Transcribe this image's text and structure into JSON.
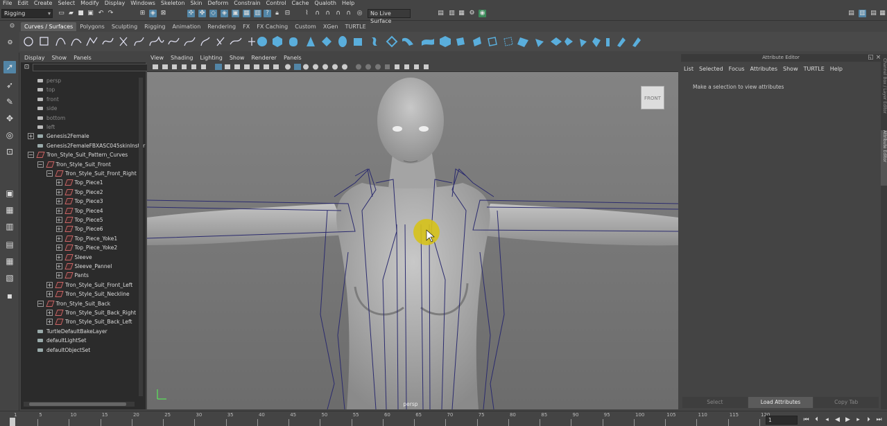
{
  "menubar": [
    "File",
    "Edit",
    "Create",
    "Select",
    "Modify",
    "Display",
    "Windows",
    "Skeleton",
    "Skin",
    "Deform",
    "Constrain",
    "Control",
    "Cache",
    "Qualoth",
    "Help"
  ],
  "status": {
    "mode": "Rigging",
    "live_surface": "No Live Surface"
  },
  "shelf_tabs": [
    "Curves / Surfaces",
    "Polygons",
    "Sculpting",
    "Rigging",
    "Animation",
    "Rendering",
    "FX",
    "FX Caching",
    "Custom",
    "XGen",
    "TURTLE"
  ],
  "outliner": {
    "menu": [
      "Display",
      "Show",
      "Panels"
    ],
    "items": [
      {
        "label": "persp",
        "depth": 0,
        "icon": "camera-icon",
        "expander": "",
        "dim": true
      },
      {
        "label": "top",
        "depth": 0,
        "icon": "camera-icon",
        "expander": "",
        "dim": true
      },
      {
        "label": "front",
        "depth": 0,
        "icon": "camera-icon",
        "expander": "",
        "dim": true
      },
      {
        "label": "side",
        "depth": 0,
        "icon": "camera-icon",
        "expander": "",
        "dim": true
      },
      {
        "label": "bottom",
        "depth": 0,
        "icon": "camera-icon",
        "expander": "",
        "dim": true
      },
      {
        "label": "left",
        "depth": 0,
        "icon": "camera-icon",
        "expander": "",
        "dim": true
      },
      {
        "label": "Genesis2Female",
        "depth": 0,
        "icon": "joint-icon",
        "expander": "+",
        "dim": false
      },
      {
        "label": "Genesis2FemaleFBXASC045skinInstar",
        "depth": 0,
        "icon": "skin-icon",
        "expander": "",
        "dim": false
      },
      {
        "label": "Tron_Style_Suit_Pattern_Curves",
        "depth": 0,
        "icon": "curve-icon",
        "expander": "-",
        "dim": false
      },
      {
        "label": "Tron_Style_Suit_Front",
        "depth": 1,
        "icon": "curve-icon",
        "expander": "-",
        "dim": false
      },
      {
        "label": "Tron_Style_Suit_Front_Right",
        "depth": 2,
        "icon": "curve-icon",
        "expander": "-",
        "dim": false
      },
      {
        "label": "Top_Piece1",
        "depth": 3,
        "icon": "curve-icon",
        "expander": "+",
        "dim": false
      },
      {
        "label": "Top_Piece2",
        "depth": 3,
        "icon": "curve-icon",
        "expander": "+",
        "dim": false
      },
      {
        "label": "Top_Piece3",
        "depth": 3,
        "icon": "curve-icon",
        "expander": "+",
        "dim": false
      },
      {
        "label": "Top_Piece4",
        "depth": 3,
        "icon": "curve-icon",
        "expander": "+",
        "dim": false
      },
      {
        "label": "Top_Piece5",
        "depth": 3,
        "icon": "curve-icon",
        "expander": "+",
        "dim": false
      },
      {
        "label": "Top_Piece6",
        "depth": 3,
        "icon": "curve-icon",
        "expander": "+",
        "dim": false
      },
      {
        "label": "Top_Piece_Yoke1",
        "depth": 3,
        "icon": "curve-icon",
        "expander": "+",
        "dim": false
      },
      {
        "label": "Top_Piece_Yoke2",
        "depth": 3,
        "icon": "curve-icon",
        "expander": "+",
        "dim": false
      },
      {
        "label": "Sleeve",
        "depth": 3,
        "icon": "curve-icon",
        "expander": "+",
        "dim": false
      },
      {
        "label": "Sleeve_Pannel",
        "depth": 3,
        "icon": "curve-icon",
        "expander": "+",
        "dim": false
      },
      {
        "label": "Pants",
        "depth": 3,
        "icon": "curve-icon",
        "expander": "+",
        "dim": false
      },
      {
        "label": "Tron_Style_Suit_Front_Left",
        "depth": 2,
        "icon": "curve-icon",
        "expander": "+",
        "dim": false
      },
      {
        "label": "Tron_Style_Suit_Neckline",
        "depth": 2,
        "icon": "curve-icon",
        "expander": "+",
        "dim": false
      },
      {
        "label": "Tron_Style_Suit_Back",
        "depth": 1,
        "icon": "curve-icon",
        "expander": "-",
        "dim": false
      },
      {
        "label": "Tron_Style_Suit_Back_Right",
        "depth": 2,
        "icon": "curve-icon",
        "expander": "+",
        "dim": false
      },
      {
        "label": "Tron_Style_Suit_Back_Left",
        "depth": 2,
        "icon": "curve-icon",
        "expander": "+",
        "dim": false
      },
      {
        "label": "TurtleDefaultBakeLayer",
        "depth": 0,
        "icon": "layer-icon",
        "expander": "",
        "dim": false
      },
      {
        "label": "defaultLightSet",
        "depth": 0,
        "icon": "set-icon",
        "expander": "",
        "dim": false
      },
      {
        "label": "defaultObjectSet",
        "depth": 0,
        "icon": "set-icon",
        "expander": "",
        "dim": false
      }
    ]
  },
  "viewport": {
    "menu": [
      "View",
      "Shading",
      "Lighting",
      "Show",
      "Renderer",
      "Panels"
    ],
    "camera_label": "persp",
    "viewcube_label": "FRONT"
  },
  "attribute_editor": {
    "title": "Attribute Editor",
    "menu": [
      "List",
      "Selected",
      "Focus",
      "Attributes",
      "Show",
      "TURTLE",
      "Help"
    ],
    "message": "Make a selection to view attributes",
    "buttons": [
      "Select",
      "Load Attributes",
      "Copy Tab"
    ]
  },
  "side_tabs": [
    "Channel Box / Layer Editor",
    "Attribute Editor"
  ],
  "timeline": {
    "ticks": [
      "1",
      "5",
      "10",
      "15",
      "20",
      "25",
      "30",
      "35",
      "40",
      "45",
      "50",
      "55",
      "60",
      "65",
      "70",
      "75",
      "80",
      "85",
      "90",
      "95",
      "100",
      "105",
      "110",
      "115",
      "120"
    ],
    "current_frame": "1"
  },
  "colors": {
    "accent": "#5285a6",
    "curve": "#2a2a6e",
    "body": "#a8a8a8"
  }
}
